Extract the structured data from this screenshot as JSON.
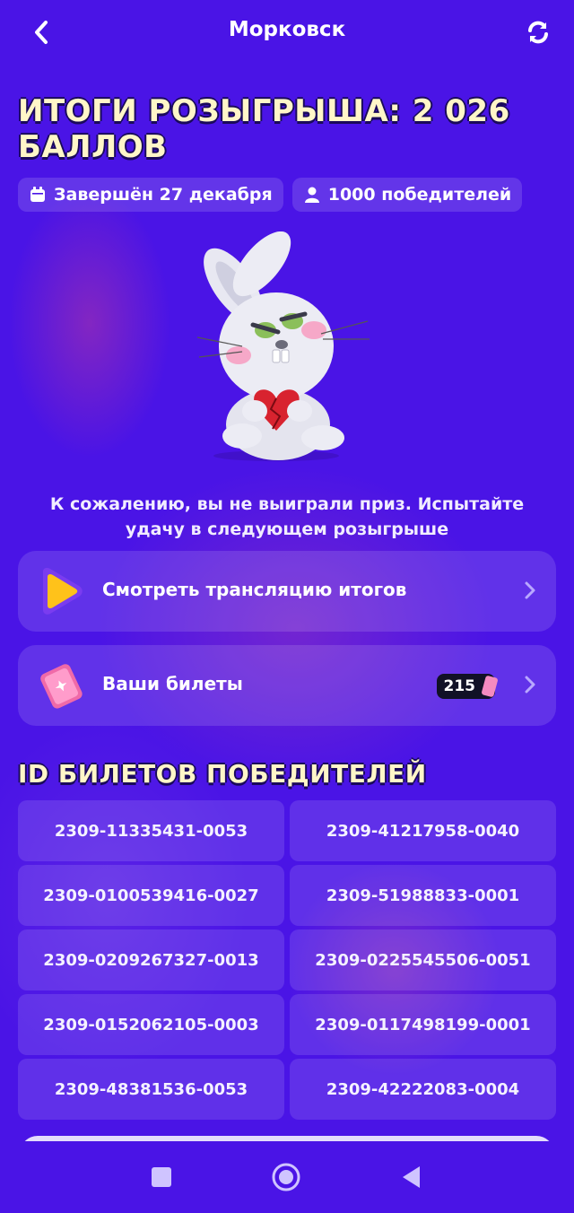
{
  "header": {
    "title": "Морковск",
    "back_icon": "chevron-left-icon",
    "refresh_icon": "refresh-icon"
  },
  "results": {
    "headline": "ИТОГИ РОЗЫГРЫША: 2 026 БАЛЛОВ",
    "date_chip": "Завершён 27 декабря",
    "winners_chip": "1000 победителей",
    "message": "К сожалению, вы не выиграли приз. Испытайте удачу в следующем розыгрыше"
  },
  "actions": {
    "watch_label": "Смотреть трансляцию итогов",
    "tickets_label": "Ваши билеты",
    "tickets_count": "215"
  },
  "winners": {
    "title": "ID БИЛЕТОВ ПОБЕДИТЕЛЕЙ",
    "ids": [
      "2309-11335431-0053",
      "2309-41217958-0040",
      "2309-0100539416-0027",
      "2309-51988833-0001",
      "2309-0209267327-0013",
      "2309-0225545506-0051",
      "2309-0152062105-0003",
      "2309-0117498199-0001",
      "2309-48381536-0053",
      "2309-42222083-0004"
    ]
  },
  "colors": {
    "background": "#4a14e6",
    "headline": "#fff6c8",
    "card": "rgba(255,255,255,0.13)"
  }
}
